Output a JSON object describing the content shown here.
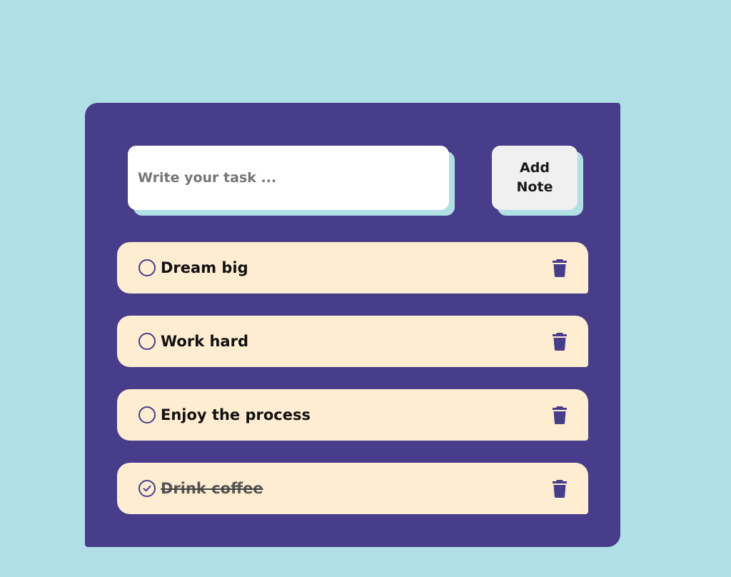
{
  "input": {
    "placeholder": "Write your task ..."
  },
  "add_button": {
    "label": "Add Note"
  },
  "tasks": [
    {
      "label": "Dream big",
      "done": false
    },
    {
      "label": "Work hard",
      "done": false
    },
    {
      "label": "Enjoy the process",
      "done": false
    },
    {
      "label": "Drink coffee",
      "done": true
    }
  ],
  "colors": {
    "background": "#b0dfe5",
    "card": "#483d8b",
    "task_bg": "#ffedd2",
    "accent": "#483d8b"
  },
  "icons": {
    "check": "circle-check-icon",
    "delete": "trash-icon"
  }
}
